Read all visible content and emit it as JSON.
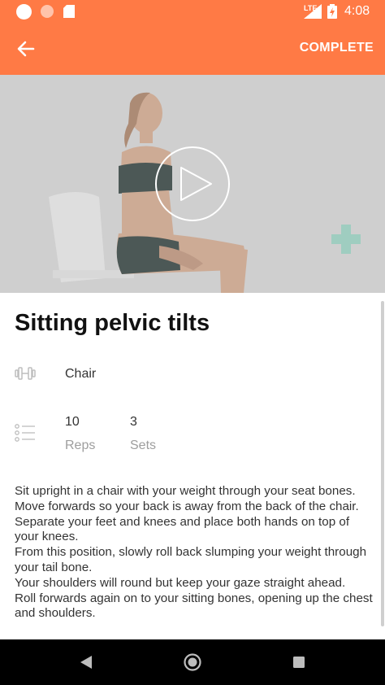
{
  "status_bar": {
    "time": "4:08",
    "network": "LTE",
    "icons": [
      "notification-dot-icon",
      "notification-dot-icon",
      "sd-card-icon",
      "signal-icon",
      "battery-charging-icon"
    ]
  },
  "app_bar": {
    "back_icon": "arrow-back-icon",
    "complete_label": "COMPLETE",
    "color": "#ff7a45"
  },
  "video": {
    "play_icon": "play-icon"
  },
  "exercise": {
    "title": "Sitting pelvic tilts",
    "equipment_icon": "dumbbell-icon",
    "equipment": "Chair",
    "list_icon": "list-icon",
    "reps_value": "10",
    "reps_label": "Reps",
    "sets_value": "3",
    "sets_label": "Sets",
    "description": [
      "Sit upright in a chair with your weight through your seat bones.",
      "Move forwards so your back is away from the back of the chair.",
      "Separate your feet and knees and place both hands on top of your knees.",
      "From this position, slowly roll back slumping your weight through your tail bone.",
      "Your shoulders will round but keep your gaze straight ahead.",
      "Roll forwards again on to your sitting bones, opening up the chest and shoulders."
    ]
  },
  "nav_bar": {
    "icons": [
      "nav-back-icon",
      "nav-home-icon",
      "nav-recents-icon"
    ]
  }
}
